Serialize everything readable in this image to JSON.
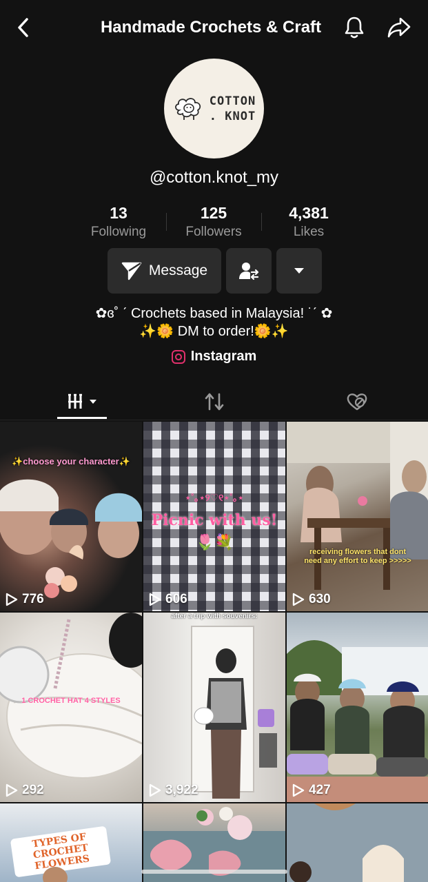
{
  "header": {
    "title": "Handmade Crochets & Craft"
  },
  "profile": {
    "avatar_text": "COTTON . KNOT",
    "handle": "@cotton.knot_my",
    "stats": [
      {
        "value": "13",
        "label": "Following"
      },
      {
        "value": "125",
        "label": "Followers"
      },
      {
        "value": "4,381",
        "label": "Likes"
      }
    ],
    "message_label": "Message",
    "bio_line1": "✿ɞ˚ ˊ Crochets based in Malaysia! ˙ˊ ✿",
    "bio_line2": "✨🌼 DM to order!🌼✨",
    "link_label": "Instagram"
  },
  "videos": [
    {
      "views": "776",
      "caption": "✨choose your character✨"
    },
    {
      "views": "606",
      "caption": "Picnic with us!"
    },
    {
      "views": "630",
      "caption": "receiving flowers that dont need any effort to keep >>>>>"
    },
    {
      "views": "292",
      "caption": "1 CROCHET HAT 4 STYLES"
    },
    {
      "views": "3,922",
      "caption": "after a trip with souvenirs:"
    },
    {
      "views": "427",
      "caption": ""
    },
    {
      "views": "",
      "caption": "TYPES OF CROCHET FLOWERS"
    },
    {
      "views": "",
      "caption": ""
    },
    {
      "views": "",
      "caption": ""
    }
  ],
  "colors": {
    "background": "#121212",
    "button": "#2c2c2c",
    "instagram": "#e1306c",
    "caption_pink": "#ff5fa2"
  }
}
